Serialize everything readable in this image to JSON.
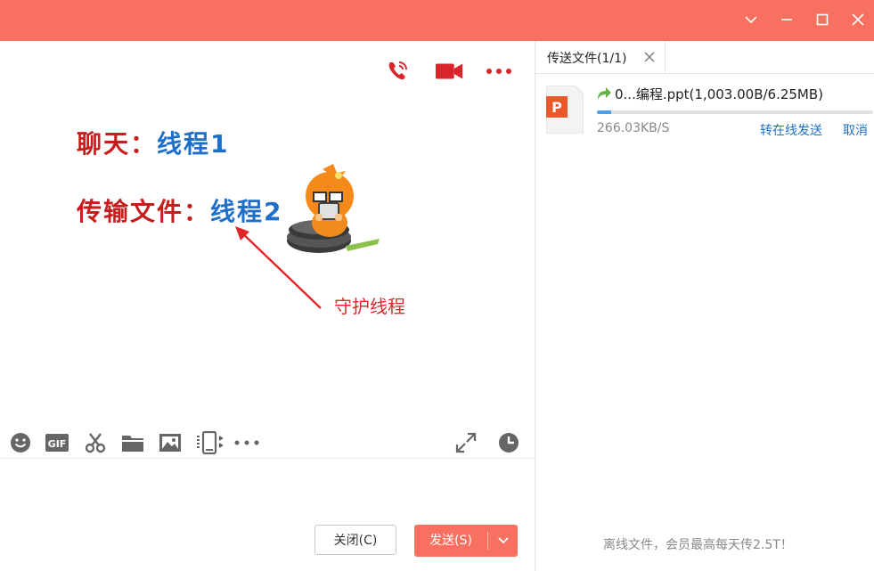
{
  "window": {
    "controls": [
      "chevron-down-icon",
      "minimize-icon",
      "maximize-icon",
      "close-icon"
    ]
  },
  "chat": {
    "top_actions": [
      "phone-call-icon",
      "video-call-icon",
      "more-icon"
    ],
    "message": {
      "line1_label": "聊天：",
      "line1_value": "线程1",
      "line2_label": "传输文件：",
      "line2_value": "线程2"
    },
    "annotation": "守护线程",
    "toolbar": [
      "emoji-icon",
      "gif-icon",
      "scissors-icon",
      "folder-icon",
      "image-icon",
      "phone-screen-icon",
      "more-icon",
      "expand-icon",
      "clock-icon"
    ],
    "close_button": "关闭(C)",
    "send_button": "发送(S)"
  },
  "transfer": {
    "tab_label": "传送文件(1/1)",
    "file": {
      "name": "0...编程.ppt(1,003.00B/6.25MB)",
      "progress_pct": 5,
      "speed": "266.03KB/S",
      "actions": [
        "转在线发送",
        "取消"
      ]
    },
    "footer_note": "离线文件，会员最高每天传2.5T！"
  },
  "colors": {
    "titlebar": "#f8705f",
    "accent_red": "#c81d1d",
    "link_blue": "#1f6fc9",
    "progress_blue": "#4aa0e6"
  }
}
